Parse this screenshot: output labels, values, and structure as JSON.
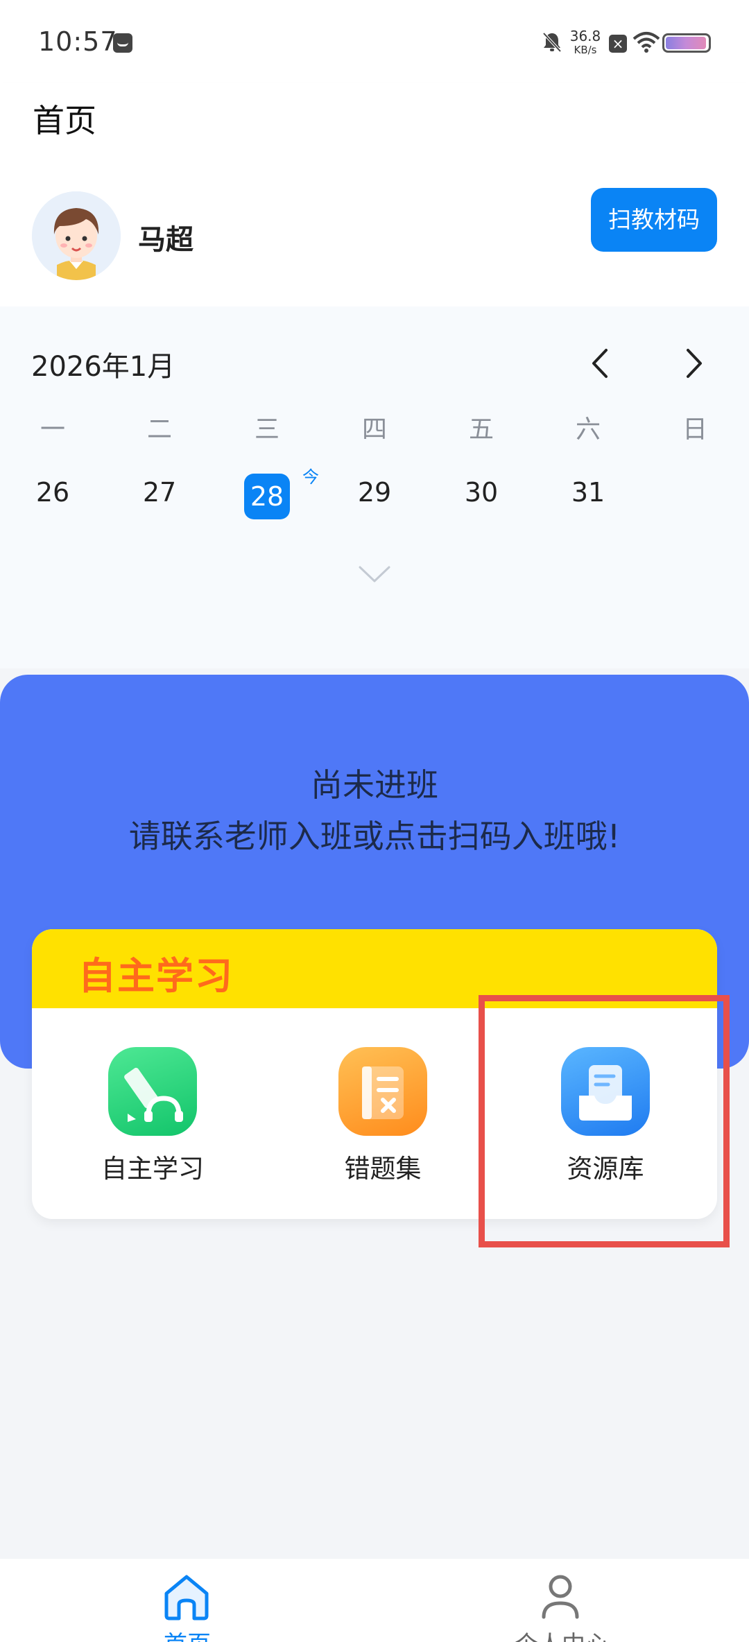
{
  "status_bar": {
    "time": "10:57",
    "net_speed_value": "36.8",
    "net_speed_unit": "KB/s",
    "battery_level": 0.9
  },
  "header": {
    "title": "首页",
    "user_name": "马超",
    "scan_button_label": "扫教材码"
  },
  "calendar": {
    "month": "2026年1月",
    "weekdays": [
      "一",
      "二",
      "三",
      "四",
      "五",
      "六",
      "日"
    ],
    "days": [
      "26",
      "27",
      "28",
      "29",
      "30",
      "31"
    ],
    "selected_day": "28",
    "today_mark": "今"
  },
  "banner": {
    "line1": "尚未进班",
    "line2": "请联系老师入班或点击扫码入班哦!"
  },
  "study": {
    "title": "自主学习",
    "items": [
      {
        "label": "自主学习",
        "icon": "pencil-headphone-icon"
      },
      {
        "label": "错题集",
        "icon": "notebook-x-icon"
      },
      {
        "label": "资源库",
        "icon": "document-tray-icon"
      }
    ]
  },
  "bottom_nav": {
    "items": [
      {
        "label": "首页",
        "icon": "home-icon",
        "active": true
      },
      {
        "label": "个人中心",
        "icon": "person-icon",
        "active": false
      }
    ]
  },
  "colors": {
    "primary": "#0a84f5",
    "banner": "#4f78f7",
    "study_header": "#ffe100",
    "study_title": "#ff6a1c",
    "highlight": "#e8504a"
  }
}
